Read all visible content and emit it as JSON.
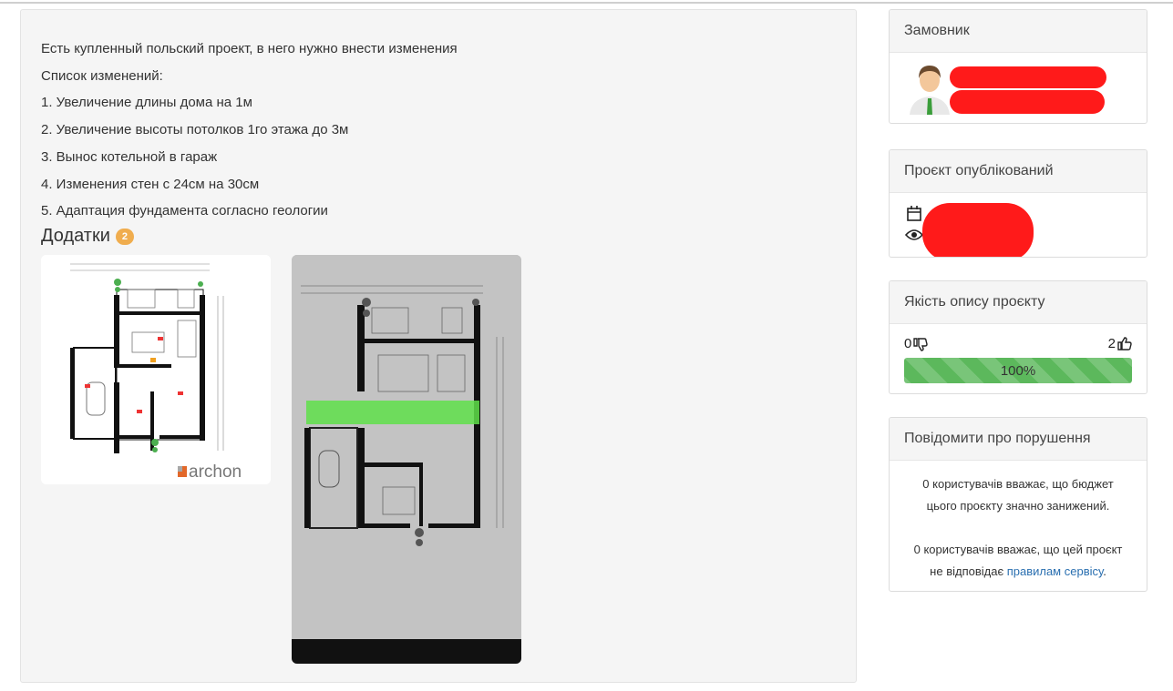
{
  "description": {
    "lines": [
      "Есть купленный польский проект, в него нужно внести изменения",
      "Список изменений:",
      "1. Увеличение длины дома на 1м",
      "2. Увеличение высоты потолков 1го этажа до 3м",
      "3. Вынос котельной в гараж",
      "4. Изменения стен с 24см на 30см",
      "5. Адаптация фундамента согласно геологии"
    ]
  },
  "attachments": {
    "title": "Додатки",
    "count": "2",
    "logo_text": "archon"
  },
  "client_panel": {
    "title": "Замовник"
  },
  "published_panel": {
    "title": "Проєкт опублікований"
  },
  "quality_panel": {
    "title": "Якість опису проєкту",
    "dislikes": "0",
    "likes": "2",
    "percent_label": "100%",
    "percent_value": 100,
    "bar_color": "#5cb85c"
  },
  "report_panel": {
    "title": "Повідомити про порушення",
    "budget_text_1": "0 користувачів вважає, що бюджет",
    "budget_text_2": "цього проєкту значно занижений.",
    "rules_text_1": "0 користувачів вважає, що цей проєкт",
    "rules_text_2": "не відповідає ",
    "rules_link": "правилам сервісу",
    "rules_text_3": "."
  },
  "icons": {
    "dislike": "thumbs-down-icon",
    "like": "thumbs-up-icon",
    "calendar": "calendar-icon",
    "views": "eye-icon",
    "avatar": "user-avatar"
  }
}
